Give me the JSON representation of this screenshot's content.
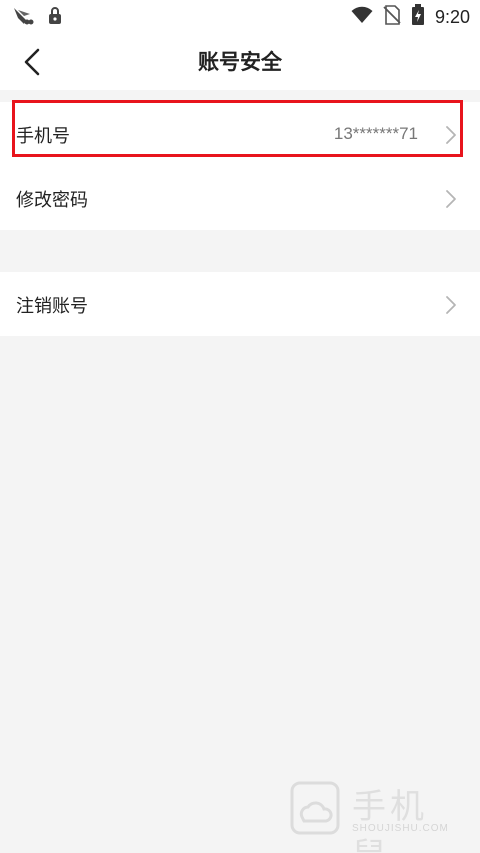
{
  "status_bar": {
    "time": "9:20",
    "icons": [
      "app-icon",
      "lock-icon",
      "wifi-icon",
      "no-sim-icon",
      "battery-charging-icon"
    ]
  },
  "header": {
    "title": "账号安全",
    "back_icon": "back-arrow-icon"
  },
  "groups": [
    {
      "items": [
        {
          "label": "手机号",
          "value": "13*******71",
          "icon": "chevron-right-icon"
        },
        {
          "label": "修改密码",
          "value": "",
          "icon": "chevron-right-icon"
        }
      ]
    },
    {
      "items": [
        {
          "label": "注销账号",
          "value": "",
          "icon": "chevron-right-icon"
        }
      ]
    }
  ],
  "highlight": {
    "color": "#e8141c",
    "target": "手机号"
  },
  "watermark": {
    "text": "手机鼠",
    "sub": "SHOUJISHU.COM"
  }
}
